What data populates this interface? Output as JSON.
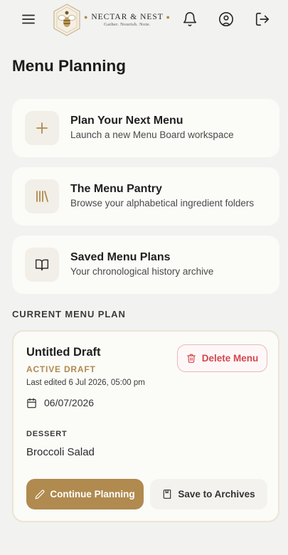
{
  "header": {
    "menu_icon": "hamburger-menu-icon",
    "logo": {
      "name": "NECTAR & NEST",
      "tagline": "Gather. Nourish. Note.",
      "badge_icon": "bee-emblem-icon"
    },
    "notifications_icon": "bell-icon",
    "profile_icon": "user-circle-icon",
    "logout_icon": "logout-icon"
  },
  "page": {
    "title": "Menu Planning"
  },
  "actions": [
    {
      "icon": "plus-icon",
      "title": "Plan Your Next Menu",
      "subtitle": "Launch a new Menu Board workspace"
    },
    {
      "icon": "library-icon",
      "title": "The Menu Pantry",
      "subtitle": "Browse your alphabetical ingredient folders"
    },
    {
      "icon": "open-book-icon",
      "title": "Saved Menu Plans",
      "subtitle": "Your chronological history archive"
    }
  ],
  "current_plan": {
    "section_label": "CURRENT MENU PLAN",
    "title": "Untitled Draft",
    "status": "ACTIVE DRAFT",
    "last_edited": "Last edited 6 Jul 2026, 05:00 pm",
    "delete_label": "Delete Menu",
    "date": "06/07/2026",
    "course_label": "DESSERT",
    "dish": "Broccoli Salad",
    "continue_label": "Continue Planning",
    "archive_label": "Save to Archives"
  },
  "colors": {
    "accent": "#b08a4f",
    "danger": "#d64550",
    "background": "#f2f2f0",
    "card": "#fbfbf8"
  }
}
